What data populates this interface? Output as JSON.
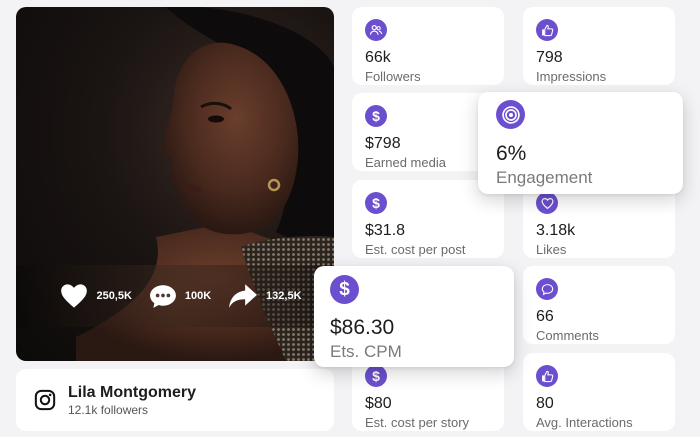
{
  "post": {
    "likes": "250,5K",
    "comments": "100K",
    "shares": "132,5K"
  },
  "profile": {
    "name": "Lila Montgomery",
    "followers": "12.1k followers"
  },
  "metrics": [
    {
      "icon": "users-icon",
      "value": "66k",
      "label": "Followers"
    },
    {
      "icon": "thumbs-up-icon",
      "value": "798",
      "label": "Impressions"
    },
    {
      "icon": "dollar-icon",
      "value": "$798",
      "label": "Earned media"
    },
    {
      "icon": "dollar-icon",
      "value": "$31.8",
      "label": "Est. cost per post"
    },
    {
      "icon": "heart-icon",
      "value": "3.18k",
      "label": "Likes"
    },
    {
      "icon": "comment-icon",
      "value": "66",
      "label": "Comments"
    },
    {
      "icon": "dollar-icon",
      "value": "$80",
      "label": "Est. cost per story"
    },
    {
      "icon": "thumbs-up-icon",
      "value": "80",
      "label": "Avg. Interactions"
    }
  ],
  "highlights": {
    "engagement": {
      "icon": "target-icon",
      "value": "6%",
      "label": "Engagement"
    },
    "cpm": {
      "icon": "dollar-icon",
      "value": "$86.30",
      "label": "Ets. CPM"
    }
  },
  "colors": {
    "accent": "#6c4fce",
    "background": "#f3f3f6"
  }
}
